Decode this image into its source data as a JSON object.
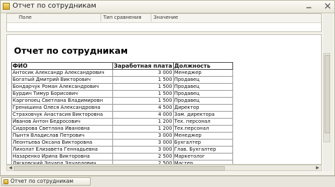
{
  "window": {
    "title": "Отчет по сотрудникам"
  },
  "filter": {
    "columns": [
      "Поле",
      "Тип сравнения",
      "Значение"
    ]
  },
  "report": {
    "title": "Отчет по сотрудникам",
    "headers": [
      "ФИО",
      "Заработная плата",
      "Должность"
    ],
    "rows": [
      [
        "Антосик Александр Александрович",
        "3 000",
        "Менеджер"
      ],
      [
        "Богатый Дмитрий Викторович",
        "1 500",
        "Продавец"
      ],
      [
        "Бондарчук Роман Александрович",
        "1 500",
        "Продавец"
      ],
      [
        "Бурдин Тимур Борисович",
        "1 500",
        "Продавец"
      ],
      [
        "Каргопоец Светлана Владимировн",
        "1 500",
        "Продавец"
      ],
      [
        "Гренишина Олеся Александровна",
        "4 500",
        "Директор"
      ],
      [
        "Страховчук Анастасия Викторовна",
        "4 000",
        "Зам. директора"
      ],
      [
        "Иванов Антон Бедросович",
        "1 200",
        "Тех. персонал"
      ],
      [
        "Сидорова Светлана Ивановна",
        "1 200",
        "Тех.персонал"
      ],
      [
        "Пынтя Владислав Петрович",
        "3 000",
        "Менеджер"
      ],
      [
        "Леонтьева Оксана Викторовна",
        "3 000",
        "Бухгалтер"
      ],
      [
        "Лихолат Елизавета Геннадьевна",
        "3 000",
        "Глав. Бухгалтер"
      ],
      [
        "Назаренко Ирина Викторовна",
        "2 500",
        "Маркетолог"
      ],
      [
        "Лясковский Эдуард Эдуардович",
        "2 500",
        "Мастер"
      ]
    ]
  },
  "taskbar": {
    "label": "Отчет по сотрудникам"
  },
  "icons": {
    "minimize": "minimize-icon",
    "close": "close-icon",
    "app": "report-icon"
  }
}
